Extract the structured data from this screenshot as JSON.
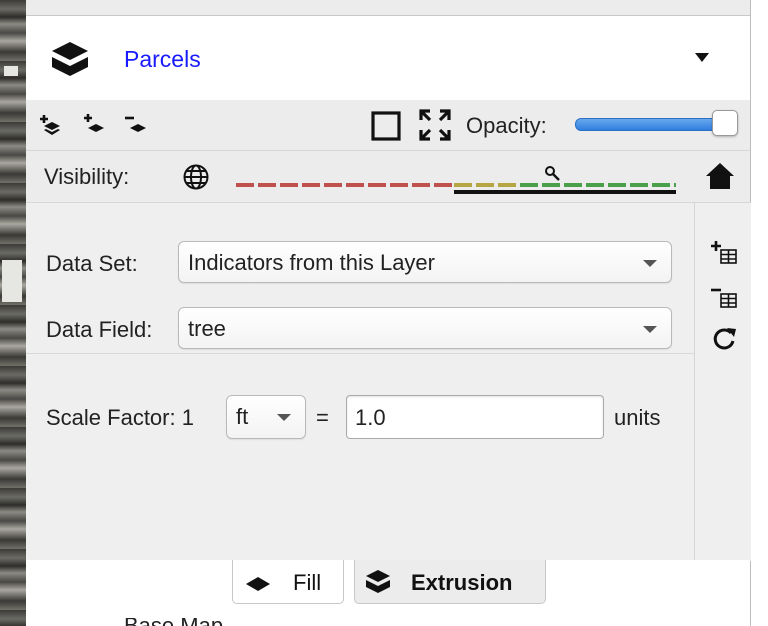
{
  "layer": {
    "name": "Parcels",
    "icon": "layers-icon"
  },
  "toolbar": {
    "opacity_label": "Opacity:",
    "opacity_value": 0.97,
    "icons": [
      "add-layer-above-icon",
      "add-layer-below-icon",
      "remove-layer-icon",
      "square-outline-icon",
      "fullscreen-icon"
    ]
  },
  "visibility": {
    "label": "Visibility:",
    "globe_icon": "globe-icon",
    "home_icon": "home-icon"
  },
  "form": {
    "data_set_label": "Data Set:",
    "data_set_value": "Indicators from this Layer",
    "data_field_label": "Data Field:",
    "data_field_value": "tree",
    "scale_factor_label": "Scale Factor: 1",
    "unit_value": "ft",
    "equals": "=",
    "scale_value": "1.0",
    "units_label": "units"
  },
  "tabs": [
    {
      "label": "Fill",
      "icon": "fill-diamond-icon",
      "active": false
    },
    {
      "label": "Extrusion",
      "icon": "layers-icon",
      "active": true
    }
  ],
  "next_layer": "Base Map",
  "colors": {
    "link_blue": "#1a1aff",
    "vis_red": "#c0504d",
    "vis_yellow": "#b5a642",
    "vis_green": "#4aa04a",
    "slider_blue": "#3d8be8"
  }
}
